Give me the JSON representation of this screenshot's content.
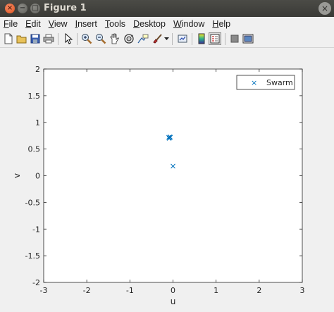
{
  "window": {
    "title": "Figure 1",
    "close_glyph": "×",
    "min_glyph": "−",
    "max_glyph": "□",
    "right_close_glyph": "×"
  },
  "menu": [
    {
      "underline": "F",
      "rest": "ile"
    },
    {
      "underline": "E",
      "rest": "dit"
    },
    {
      "underline": "V",
      "rest": "iew"
    },
    {
      "underline": "I",
      "rest": "nsert"
    },
    {
      "underline": "T",
      "rest": "ools"
    },
    {
      "underline": "D",
      "rest": "esktop"
    },
    {
      "underline": "W",
      "rest": "indow"
    },
    {
      "underline": "H",
      "rest": "elp"
    }
  ],
  "toolbar_icons": [
    "new-figure-icon",
    "open-file-icon",
    "save-icon",
    "print-icon",
    "edit-plot-arrow-icon",
    "zoom-in-icon",
    "zoom-out-icon",
    "pan-hand-icon",
    "rotate-3d-icon",
    "data-cursor-icon",
    "brush-icon",
    "brush-dropdown-icon",
    "link-plot-icon",
    "insert-colorbar-icon",
    "insert-legend-icon",
    "hide-plot-tools-icon",
    "show-plot-tools-icon"
  ],
  "chart_data": {
    "type": "scatter",
    "xlabel": "u",
    "ylabel": "v",
    "xlim": [
      -3,
      3
    ],
    "ylim": [
      -2,
      2
    ],
    "xticks": [
      "-3",
      "-2",
      "-1",
      "0",
      "1",
      "2",
      "3"
    ],
    "yticks": [
      "-2",
      "-1.5",
      "-1",
      "-0.5",
      "0",
      "0.5",
      "1",
      "1.5",
      "2"
    ],
    "grid": false,
    "legend_position": "top-right",
    "marker": "x",
    "color": "#0072bd",
    "series": [
      {
        "name": "Swarm",
        "x": [
          -0.1,
          -0.08,
          -0.06,
          -0.09,
          -0.07,
          0.0
        ],
        "y": [
          0.72,
          0.71,
          0.72,
          0.7,
          0.73,
          0.18
        ]
      }
    ]
  }
}
